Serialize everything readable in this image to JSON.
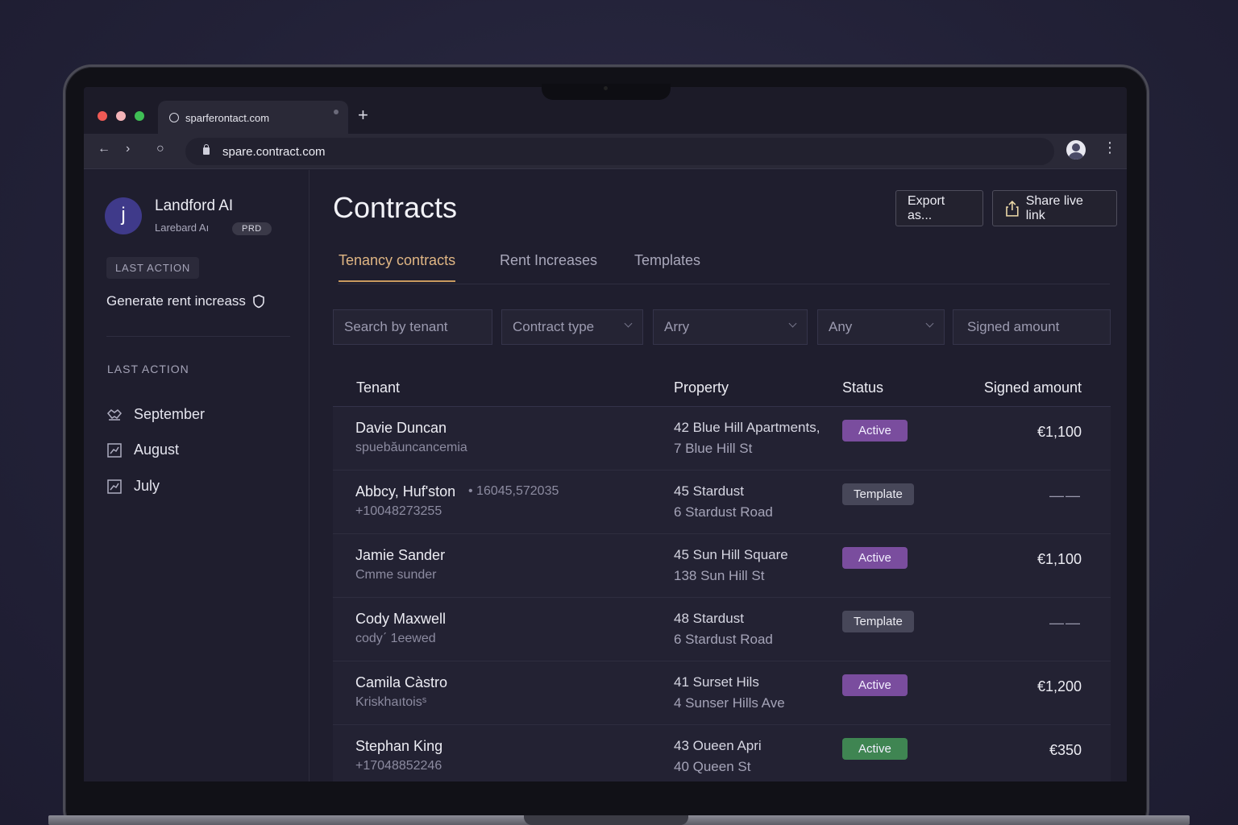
{
  "browser": {
    "tab_title": "sparferontact.com",
    "new_tab": "+",
    "back": "←",
    "forward": "›",
    "reload": "○",
    "url": "spare.contract.com",
    "menu": "⋮"
  },
  "sidebar": {
    "avatar_letter": "j",
    "org_name": "Landford AI",
    "org_sub": "Larebard Aı",
    "env_badge": "PRD",
    "last_action_chip": "LAST ACTION",
    "last_action_item": "Generate rent increass",
    "section_heading": "LAST ACTION",
    "items": [
      {
        "label": "September",
        "icon": "handshake-icon"
      },
      {
        "label": "August",
        "icon": "chart-icon"
      },
      {
        "label": "July",
        "icon": "chart-icon"
      }
    ]
  },
  "main": {
    "title": "Contracts",
    "export_label": "Export as...",
    "share_label": "Share live link",
    "tabs": [
      {
        "label": "Tenancy contracts",
        "active": true
      },
      {
        "label": "Rent Increases",
        "active": false
      },
      {
        "label": "Templates",
        "active": false
      }
    ],
    "filters": {
      "search_placeholder": "Search by tenant",
      "contract_type": "Contract type",
      "any1": "Arry",
      "any2": "Any",
      "signed_amount": "Signed amount"
    },
    "table": {
      "headers": {
        "tenant": "Tenant",
        "property": "Property",
        "status": "Status",
        "amount": "Signed amount"
      },
      "rows": [
        {
          "name": "Davie Duncan",
          "sub": "spuebăuncancemia",
          "extra": "",
          "prop1": "42 Blue Hill Apartments,",
          "prop2": "7 Blue Hill St",
          "status": "Active",
          "status_style": "active",
          "amount": "€1,100"
        },
        {
          "name": "Abbcy, Huf'ston",
          "sub": "+10048273255",
          "extra": "• 16045,572035",
          "prop1": "45 Stardust",
          "prop2": "6 Stardust Road",
          "status": "Template",
          "status_style": "template",
          "amount": "——"
        },
        {
          "name": "Jamie Sander",
          "sub": "Cmme sunder",
          "extra": "",
          "prop1": "45 Sun Hill Square",
          "prop2": "138 Sun Hill St",
          "status": "Active",
          "status_style": "active",
          "amount": "€1,100"
        },
        {
          "name": "Cody Maxwell",
          "sub": "codyˊ  1eewed",
          "extra": "",
          "prop1": "48 Stardust",
          "prop2": "6 Stardust Road",
          "status": "Template",
          "status_style": "template",
          "amount": "——"
        },
        {
          "name": "Camila Càstro",
          "sub": "Kriskhaıtoisˢ",
          "extra": "",
          "prop1": "41 Surset Hils",
          "prop2": "4 Sunser Hills Ave",
          "status": "Active",
          "status_style": "active",
          "amount": "€1,200"
        },
        {
          "name": "Stephan King",
          "sub": "+17048852246",
          "extra": "",
          "prop1": "43 Oueen Apri",
          "prop2": "40 Queen St",
          "status": "Active",
          "status_style": "green",
          "amount": "€350"
        }
      ]
    }
  },
  "colors": {
    "accent_tab": "#e0b684",
    "active_badge": "#7a4d9e",
    "green_badge": "#3f8552",
    "template_badge": "#474759"
  }
}
